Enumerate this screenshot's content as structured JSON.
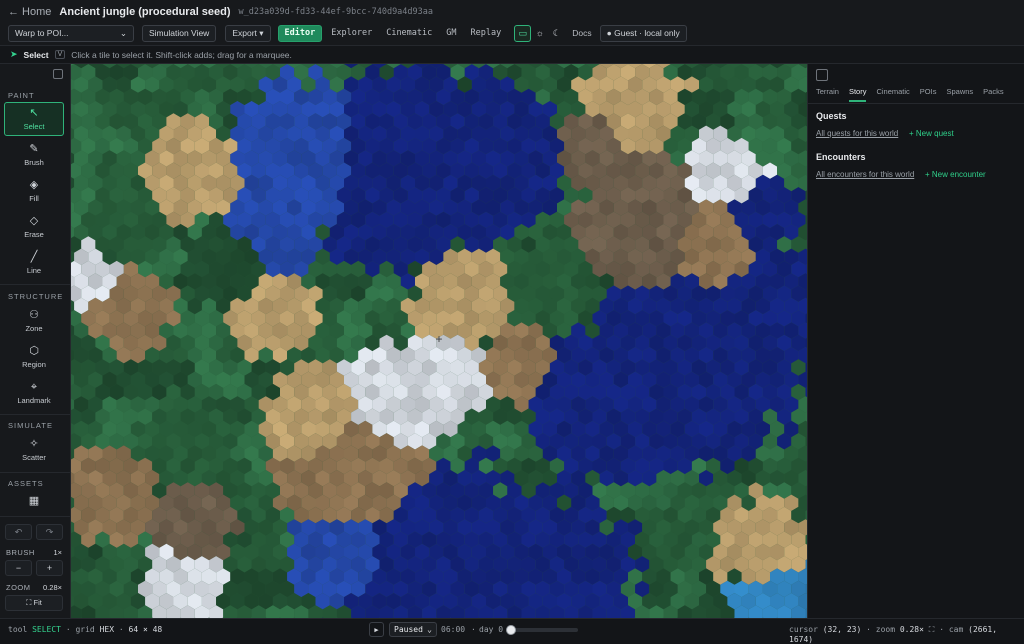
{
  "header": {
    "home_label": "← Home",
    "world_title": "Ancient jungle (procedural seed)",
    "world_id": "w_d23a039d-fd33-44ef-9bcc-740d9a4d93aa",
    "warp_select_value": "Warp to POI...",
    "simulation_view_label": "Simulation View",
    "export_label": "Export ▾",
    "modes": [
      "Editor",
      "Explorer",
      "Cinematic",
      "GM",
      "Replay"
    ],
    "active_mode": "Editor",
    "theme_icons": [
      "monitor-icon",
      "sun-icon",
      "moon-icon"
    ],
    "docs_label": "Docs",
    "guest_label": "● Guest · local only"
  },
  "hint": {
    "tool": "Select",
    "shortcut": "V",
    "text": "Click a tile to select it. Shift-click adds; drag for a marquee."
  },
  "sidebar": {
    "paint_label": "PAINT",
    "paint_tools": [
      {
        "label": "Select",
        "icon": "cursor-icon",
        "active": true
      },
      {
        "label": "Brush",
        "icon": "brush-icon"
      },
      {
        "label": "Fill",
        "icon": "bucket-icon"
      },
      {
        "label": "Erase",
        "icon": "eraser-icon"
      },
      {
        "label": "Line",
        "icon": "line-icon"
      }
    ],
    "structure_label": "STRUCTURE",
    "structure_tools": [
      {
        "label": "Zone",
        "icon": "zone-icon"
      },
      {
        "label": "Region",
        "icon": "hexagon-icon"
      },
      {
        "label": "Landmark",
        "icon": "pin-icon"
      }
    ],
    "simulate_label": "SIMULATE",
    "simulate_tools": [
      {
        "label": "Scatter",
        "icon": "sparkle-icon"
      }
    ],
    "assets_label": "ASSETS",
    "brush_label": "BRUSH",
    "brush_value": "1×",
    "zoom_label": "ZOOM",
    "zoom_value": "0.28×",
    "fit_label": "⛶ Fit"
  },
  "panel": {
    "tabs": [
      "Terrain",
      "Story",
      "Cinematic",
      "POIs",
      "Spawns",
      "Packs"
    ],
    "active_tab": "Story",
    "quests_title": "Quests",
    "quests_link": "All quests for this world",
    "new_quest": "+ New quest",
    "encounters_title": "Encounters",
    "encounters_link": "All encounters for this world",
    "new_encounter": "+ New encounter"
  },
  "status": {
    "tool_label": "tool",
    "tool_value": "SELECT",
    "grid_label": "grid",
    "grid_value": "HEX",
    "grid_size": "64 × 48",
    "play_icon": "play-icon",
    "speed_value": "Paused",
    "clock": "06:00",
    "day": "day 0",
    "time_progress": 0.0,
    "cursor_label": "cursor",
    "cursor_value": "(32, 23)",
    "zoom_label": "zoom",
    "zoom_value": "0.28×",
    "cam_label": "cam",
    "cam_value": "(2661, 1674)"
  },
  "map": {
    "type": "hex",
    "cols": 64,
    "rows": 48,
    "terrain_colors": {
      "grass": "#2f6e46",
      "forest": "#265a38",
      "dense_forest": "#1f4a2f",
      "shallow": "#2f7fb8",
      "water": "#2447a6",
      "deep_water": "#13237a",
      "sand": "#b59a6a",
      "dirt": "#8a7050",
      "rock": "#6a5b4a",
      "snow": "#cdd2d9"
    }
  }
}
